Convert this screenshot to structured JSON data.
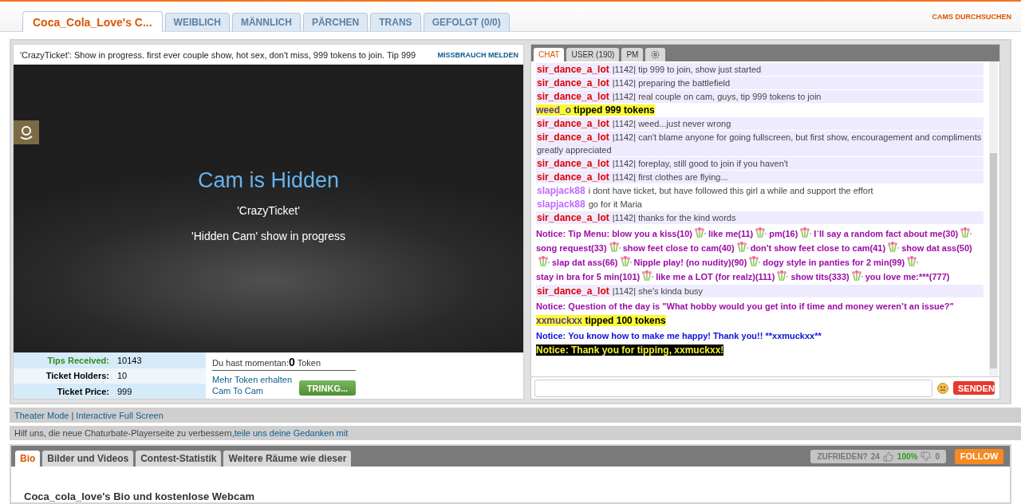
{
  "nav": {
    "tabs": [
      {
        "label": "Coca_Cola_Love's C...",
        "selected": true
      },
      {
        "label": "WEIBLICH",
        "selected": false
      },
      {
        "label": "MÄNNLICH",
        "selected": false
      },
      {
        "label": "PÄRCHEN",
        "selected": false
      },
      {
        "label": "TRANS",
        "selected": false
      },
      {
        "label": "GEFOLGT (0/0)",
        "selected": false
      }
    ],
    "search_link": "CAMS DURCHSUCHEN"
  },
  "room": {
    "subject": "'CrazyTicket': Show in progress. first ever couple show, hot sex, don't miss, 999 tokens to join. Tip 999",
    "report_link": "MISSBRAUCH MELDEN",
    "video": {
      "heading": "Cam is Hidden",
      "line_1": "'CrazyTicket'",
      "line_2": "'Hidden Cam' show in progress"
    },
    "stats": [
      {
        "label": "Tips Received:",
        "value": "10143",
        "color": "#2e8b1e"
      },
      {
        "label": "Ticket Holders:",
        "value": "10",
        "color": "#000000"
      },
      {
        "label": "Ticket Price:",
        "value": "999",
        "color": "#000000"
      }
    ],
    "balance": {
      "label": "Du hast momentan:",
      "amount": "0",
      "unit": "Token"
    },
    "links": [
      "Mehr Token erhalten",
      "Cam To Cam"
    ],
    "tip_button": "TRINKG..."
  },
  "chat": {
    "tabs": [
      {
        "label": "CHAT",
        "kind": "text",
        "selected": true
      },
      {
        "label": "USER (190)",
        "kind": "text",
        "selected": false
      },
      {
        "label": "PM",
        "kind": "text",
        "selected": false
      },
      {
        "kind": "settings",
        "selected": false
      }
    ],
    "messages": [
      {
        "kind": "user",
        "user": "sir_dance_a_lot",
        "color": "#dd0000",
        "highlighted": true,
        "text": "|1142| tip 999 to join, show just started"
      },
      {
        "kind": "user",
        "user": "sir_dance_a_lot",
        "color": "#dd0000",
        "highlighted": true,
        "text": "|1142| preparing the battlefield"
      },
      {
        "kind": "user",
        "user": "sir_dance_a_lot",
        "color": "#dd0000",
        "highlighted": true,
        "text": "|1142| real couple on cam, guys, tip 999 tokens to join"
      },
      {
        "kind": "tip",
        "user": "weed_o",
        "text": "tipped 999 tokens"
      },
      {
        "kind": "user",
        "user": "sir_dance_a_lot",
        "color": "#dd0000",
        "highlighted": true,
        "text": "|1142| weed...just never wrong"
      },
      {
        "kind": "user",
        "user": "sir_dance_a_lot",
        "color": "#dd0000",
        "highlighted": true,
        "text": "|1142| can't blame anyone for going fullscreen, but first show, encouragement and compliments greatly appreciated"
      },
      {
        "kind": "user",
        "user": "sir_dance_a_lot",
        "color": "#dd0000",
        "highlighted": true,
        "text": "|1142| foreplay, still good to join if you haven't"
      },
      {
        "kind": "user",
        "user": "sir_dance_a_lot",
        "color": "#dd0000",
        "highlighted": true,
        "text": "|1142| first clothes are flying..."
      },
      {
        "kind": "user",
        "user": "slapjack88",
        "color": "#be6aff",
        "highlighted": false,
        "text": "i dont have ticket, but have followed this girl a while and support the effort"
      },
      {
        "kind": "user",
        "user": "slapjack88",
        "color": "#be6aff",
        "highlighted": false,
        "text": "go for it Maria"
      },
      {
        "kind": "user",
        "user": "sir_dance_a_lot",
        "color": "#dd0000",
        "highlighted": true,
        "text": "|1142| thanks for the kind words"
      },
      {
        "kind": "menu",
        "color": "#9e0aa8",
        "parts": [
          "Notice: Tip Menu: blow you a kiss(10)",
          "like me(11)",
          "pm(16)",
          "I`ll say a random fact about me(30)",
          "song request(33)",
          "show feet close to cam(40)",
          "don't show feet close to cam(41)",
          "show dat ass(50)",
          "slap dat ass(66)",
          "Nipple play! (no nudity)(90)",
          "dogy style in panties for 2 min(99)",
          "stay in bra for 5 min(101)",
          "like me a LOT (for realz)(111)",
          "show tits(333)",
          "you love me:***(777)"
        ]
      },
      {
        "kind": "user",
        "user": "sir_dance_a_lot",
        "color": "#dd0000",
        "highlighted": true,
        "text": "|1142| she's kinda busy"
      },
      {
        "kind": "notice",
        "color": "#9e0aa8",
        "text": "Notice: Question of the day is \"What hobby would you get into if time and money weren’t an issue?\""
      },
      {
        "kind": "tip",
        "user": "xxmuckxx",
        "text": "tipped 100 tokens"
      },
      {
        "kind": "notice",
        "color": "#1010dd",
        "text": "Notice: You know how to make me happy! Thank you!! **xxmuckxx**"
      },
      {
        "kind": "banner",
        "text": "Notice: Thank you for tipping, xxmuckxx!"
      }
    ],
    "send_button": "SENDEN"
  },
  "player_links": {
    "theater": "Theater Mode",
    "separator": "|",
    "fullscreen": "Interactive Full Screen"
  },
  "feedback": {
    "text": "Hilf uns, die neue Chaturbate-Playerseite zu verbessern,",
    "link": "teile uns deine Gedanken mit"
  },
  "info": {
    "tabs": [
      {
        "label": "Bio",
        "selected": true
      },
      {
        "label": "Bilder und Videos",
        "selected": false
      },
      {
        "label": "Contest-Statistik",
        "selected": false
      },
      {
        "label": "Weitere Räume wie dieser",
        "selected": false
      }
    ],
    "satisfaction": {
      "label": "ZUFRIEDEN?",
      "up_count": "24",
      "percent": "100%",
      "down_count": "0"
    },
    "follow_button": "FOLLOW",
    "bio_heading": "Coca_cola_love's Bio und kostenlose Webcam"
  }
}
